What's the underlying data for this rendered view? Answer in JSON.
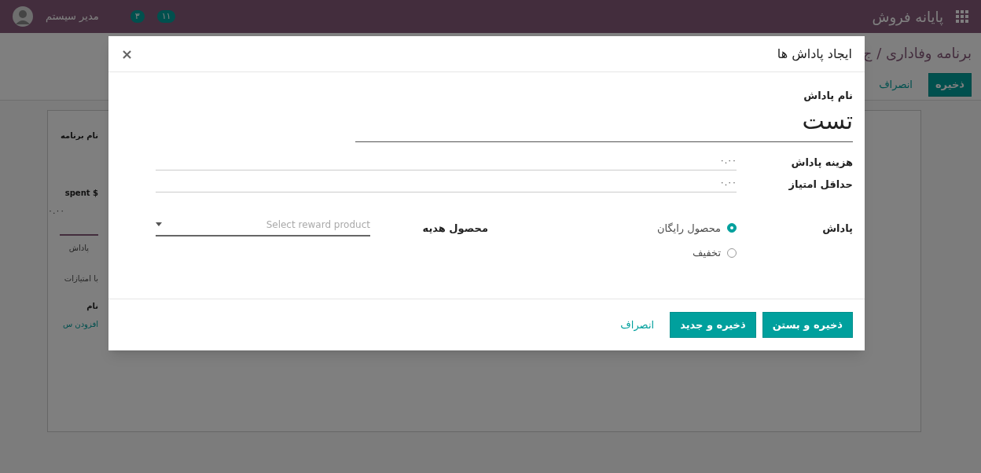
{
  "top_bar": {
    "app_title": "پایانه فروش",
    "user_name": "مدیر سیستم",
    "badges": [
      {
        "count": "۱۱"
      },
      {
        "count": "۳"
      }
    ]
  },
  "control_panel": {
    "breadcrumb": "برنامه وفاداری / ج",
    "buttons": [
      {
        "label": "ذخیره",
        "kind": "primary"
      },
      {
        "label": "انصراف",
        "kind": "link"
      }
    ]
  },
  "form_fragments": {
    "program_name_label": "نام برنامه",
    "spent_label": "$ spent",
    "spent_value": "۰.۰۰",
    "tab": {
      "label": "پاداش",
      "selected": true
    },
    "hint": "با امتیازات",
    "column_name": "نام",
    "add_line": "افزودن س"
  },
  "dialog": {
    "title": "ایجاد پاداش ها",
    "close": "×",
    "name_label": "نام پاداش",
    "name_value": "تست",
    "fields": [
      {
        "label": "هزینه پاداش",
        "value": "۰.۰۰"
      },
      {
        "label": "حداقل امتیاز",
        "value": "۰.۰۰"
      }
    ],
    "reward": {
      "label": "پاداش",
      "options": [
        {
          "label": "محصول رایگان",
          "selected": true
        },
        {
          "label": "تخفیف",
          "selected": false
        }
      ]
    },
    "product": {
      "label": "محصول هدیه",
      "placeholder": "Select reward product"
    },
    "buttons": [
      {
        "label": "ذخیره و بستن",
        "kind": "primary"
      },
      {
        "label": "ذخیره و جدید",
        "kind": "primary"
      },
      {
        "label": "انصراف",
        "kind": "link"
      }
    ]
  }
}
